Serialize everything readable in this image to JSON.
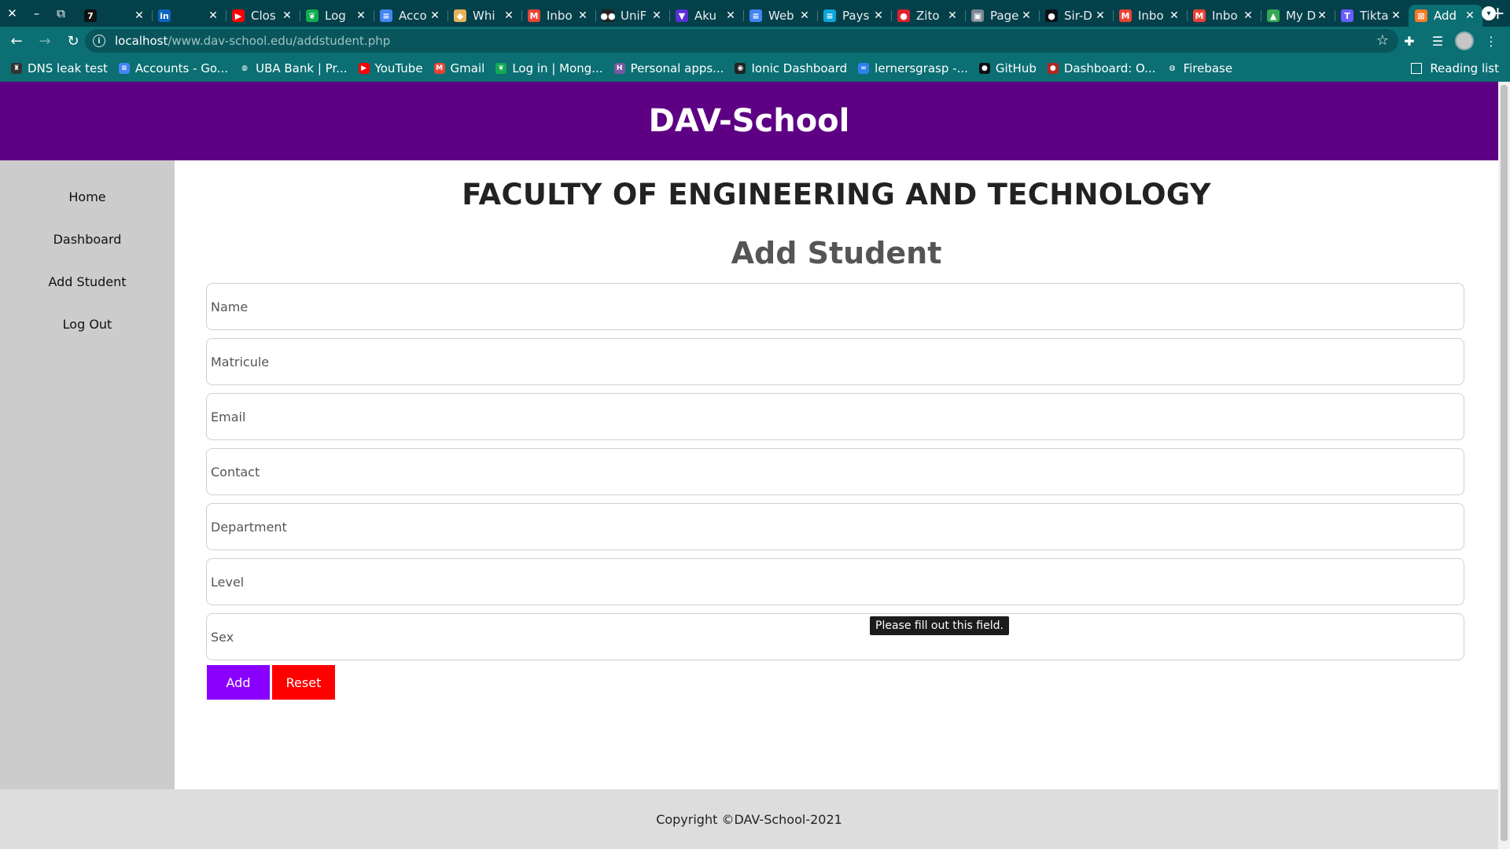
{
  "browser": {
    "tabs": [
      {
        "title": "",
        "icon": "t7-icon",
        "color": "#111111",
        "glyph": "7"
      },
      {
        "title": "",
        "icon": "linkedin-icon",
        "color": "#0a66c2",
        "glyph": "in"
      },
      {
        "title": "Clos",
        "icon": "youtube-icon",
        "color": "#ff0000",
        "glyph": "▶"
      },
      {
        "title": "Log",
        "icon": "mongodb-leaf-icon",
        "color": "#13aa52",
        "glyph": "❦"
      },
      {
        "title": "Acco",
        "icon": "docs-icon",
        "color": "#4285f4",
        "glyph": "≡"
      },
      {
        "title": "Whi",
        "icon": "whimsical-icon",
        "color": "#e6b35a",
        "glyph": "◆"
      },
      {
        "title": "Inbo",
        "icon": "gmail-icon",
        "color": "#ea4335",
        "glyph": "M"
      },
      {
        "title": "UniF",
        "icon": "unifi-icon",
        "color": "#222222",
        "glyph": "●●"
      },
      {
        "title": "Aku",
        "icon": "shield-icon",
        "color": "#5a2fd6",
        "glyph": "▼"
      },
      {
        "title": "Web",
        "icon": "docs-icon",
        "color": "#4285f4",
        "glyph": "≡"
      },
      {
        "title": "Pays",
        "icon": "paystack-icon",
        "color": "#0aa5db",
        "glyph": "≡"
      },
      {
        "title": "Zito",
        "icon": "zito-icon",
        "color": "#e0202f",
        "glyph": "●"
      },
      {
        "title": "Page",
        "icon": "page-icon",
        "color": "#7b8794",
        "glyph": "▣"
      },
      {
        "title": "Sir-D",
        "icon": "github-icon",
        "color": "#0d1117",
        "glyph": "●"
      },
      {
        "title": "Inbo",
        "icon": "gmail-icon",
        "color": "#ea4335",
        "glyph": "M"
      },
      {
        "title": "Inbo",
        "icon": "gmail-icon",
        "color": "#ea4335",
        "glyph": "M"
      },
      {
        "title": "My D",
        "icon": "drive-icon",
        "color": "#34a853",
        "glyph": "▲"
      },
      {
        "title": "Tikta",
        "icon": "tiktalk-icon",
        "color": "#6b5cff",
        "glyph": "T"
      },
      {
        "title": "Add",
        "icon": "xampp-icon",
        "color": "#fb7a24",
        "glyph": "⊠",
        "active": true
      }
    ],
    "url_host": "localhost",
    "url_path": "/www.dav-school.edu/addstudent.php",
    "bookmarks": [
      {
        "label": "DNS leak test",
        "icon": "dns-leak-icon",
        "color": "#333333",
        "glyph": "♜"
      },
      {
        "label": "Accounts - Go...",
        "icon": "docs-icon",
        "color": "#4285f4",
        "glyph": "≡"
      },
      {
        "label": "UBA Bank | Pr...",
        "icon": "globe-icon",
        "color": "#0b6f73",
        "glyph": "◍"
      },
      {
        "label": "YouTube",
        "icon": "youtube-icon",
        "color": "#ff0000",
        "glyph": "▶"
      },
      {
        "label": "Gmail",
        "icon": "gmail-icon",
        "color": "#ea4335",
        "glyph": "M"
      },
      {
        "label": "Log in | Mong...",
        "icon": "mongodb-leaf-icon",
        "color": "#13aa52",
        "glyph": "❦"
      },
      {
        "label": "Personal apps...",
        "icon": "heroku-icon",
        "color": "#79589f",
        "glyph": "H"
      },
      {
        "label": "Ionic Dashboard",
        "icon": "ionic-icon",
        "color": "#222222",
        "glyph": "◉"
      },
      {
        "label": "lernersgrasp -...",
        "icon": "loop-icon",
        "color": "#2f80ed",
        "glyph": "∞"
      },
      {
        "label": "GitHub",
        "icon": "github-icon",
        "color": "#0d1117",
        "glyph": "●"
      },
      {
        "label": "Dashboard: O...",
        "icon": "dashboard-icon",
        "color": "#b3261e",
        "glyph": "●"
      },
      {
        "label": "Firebase",
        "icon": "globe-icon",
        "color": "#0b6f73",
        "glyph": "◍"
      }
    ],
    "reading_list": "Reading list"
  },
  "site": {
    "title": "DAV-School",
    "sidebar": [
      "Home",
      "Dashboard",
      "Add Student",
      "Log Out"
    ],
    "faculty_heading": "FACULTY OF ENGINEERING AND TECHNOLOGY",
    "form_heading": "Add Student",
    "fields": [
      {
        "name": "name-input",
        "placeholder": "Name"
      },
      {
        "name": "matricule-input",
        "placeholder": "Matricule"
      },
      {
        "name": "email-input",
        "placeholder": "Email"
      },
      {
        "name": "contact-input",
        "placeholder": "Contact"
      },
      {
        "name": "department-input",
        "placeholder": "Department"
      },
      {
        "name": "level-input",
        "placeholder": "Level"
      },
      {
        "name": "sex-input",
        "placeholder": "Sex"
      }
    ],
    "add_label": "Add",
    "reset_label": "Reset",
    "tooltip": "Please fill out this field.",
    "footer": "Copyright ©DAV-School-2021"
  },
  "colors": {
    "tabbar": "#04404a",
    "toolbar": "#0b6f73",
    "header": "#5d0084",
    "add_button": "#8a00ff",
    "reset_button": "#ff0000"
  }
}
